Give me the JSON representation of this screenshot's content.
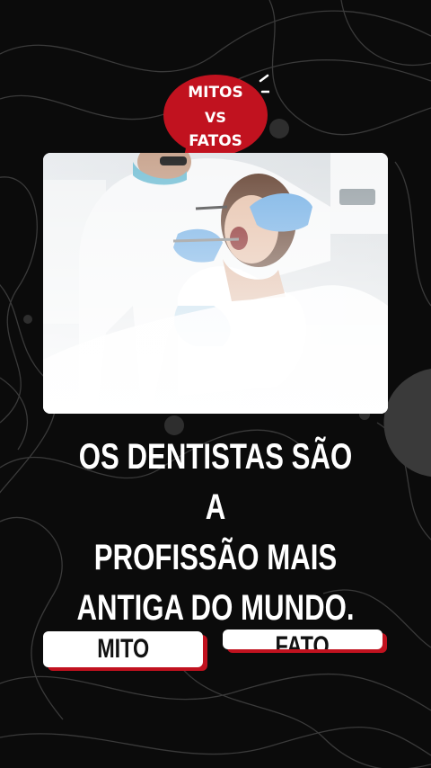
{
  "badge": {
    "line1": "MITOS",
    "line2": "VS",
    "line3": "FATOS",
    "color": "#c1121f"
  },
  "photo": {
    "description_icon": "dentist-photo"
  },
  "question": {
    "text": "OS DENTISTAS SÃO A\nPROFISSÃO MAIS\nANTIGA DO MUNDO."
  },
  "answers": {
    "mito_label": "MITO",
    "fato_label": "FATO",
    "shadow_color": "#c1121f"
  }
}
